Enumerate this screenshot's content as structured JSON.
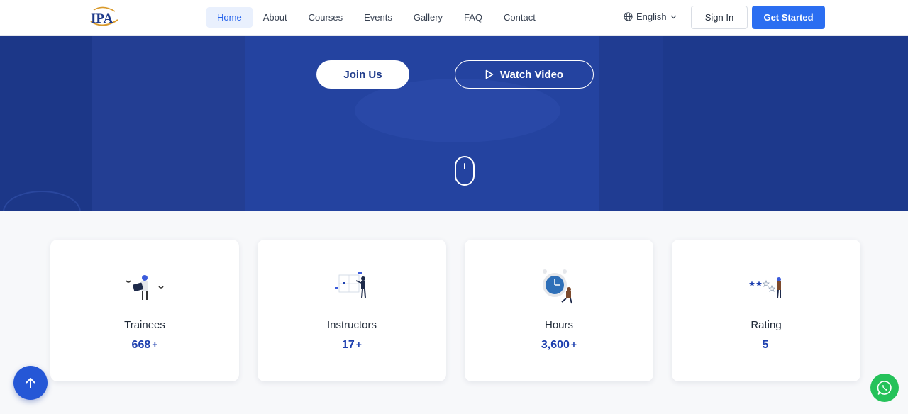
{
  "header": {
    "logo_text": "IPA",
    "nav": [
      "Home",
      "About",
      "Courses",
      "Events",
      "Gallery",
      "FAQ",
      "Contact"
    ],
    "active_nav": "Home",
    "language": "English",
    "sign_in": "Sign In",
    "get_started": "Get Started"
  },
  "hero": {
    "join_label": "Join Us",
    "video_label": "Watch Video"
  },
  "stats": [
    {
      "label": "Trainees",
      "value": "668",
      "suffix": "+"
    },
    {
      "label": "Instructors",
      "value": "17",
      "suffix": "+"
    },
    {
      "label": "Hours",
      "value": "3,600",
      "suffix": "+"
    },
    {
      "label": "Rating",
      "value": "5",
      "suffix": ""
    }
  ],
  "colors": {
    "primary": "#2b6ef1",
    "hero_bg": "#1f3b90",
    "stat_value": "#1e40af",
    "whatsapp": "#25c25a"
  }
}
